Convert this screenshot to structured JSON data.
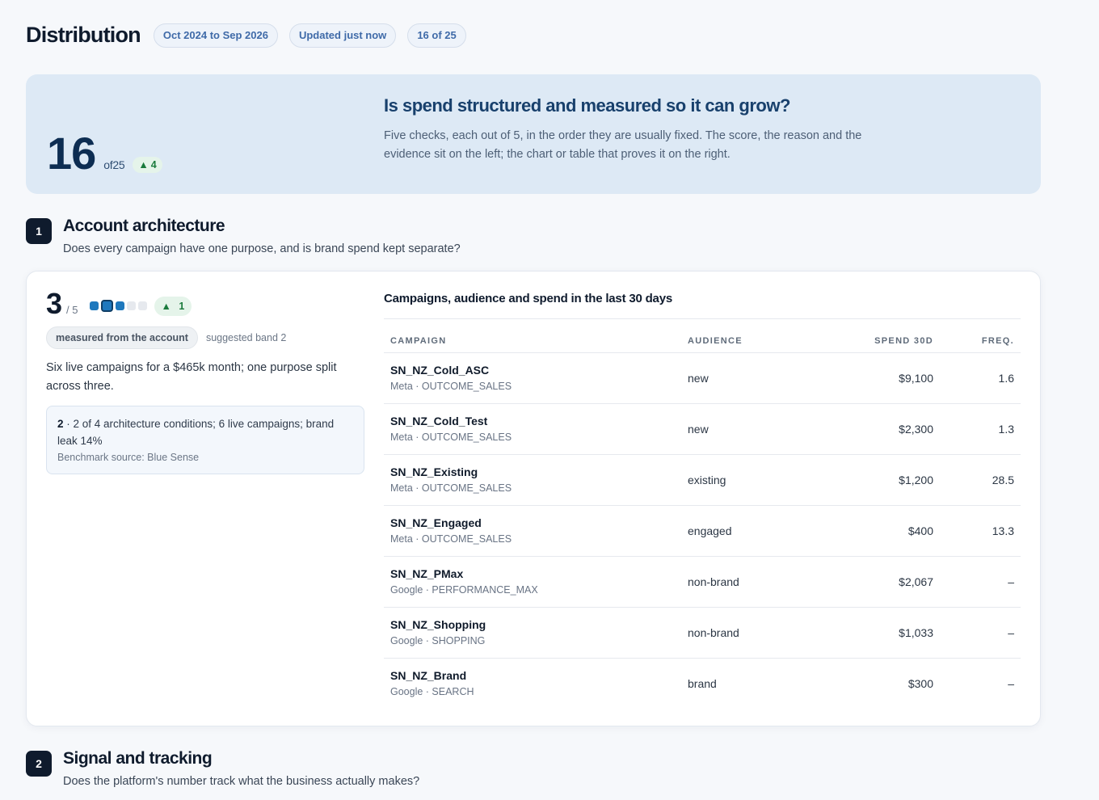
{
  "header": {
    "title": "Distribution",
    "pills": [
      "Oct 2024 to Sep 2026",
      "Updated just now",
      "16 of 25"
    ]
  },
  "hero": {
    "score": "16",
    "of_label": "of25",
    "delta": "4",
    "question": "Is spend structured and measured so it can grow?",
    "description": "Five checks, each out of 5, in the order they are usually fixed. The score, the reason and the evidence sit on the left; the chart or table that proves it on the right."
  },
  "sections": [
    {
      "number": "1",
      "title": "Account architecture",
      "subtitle": "Does every campaign have one purpose, and is brand spend kept separate?"
    },
    {
      "number": "2",
      "title": "Signal and tracking",
      "subtitle": "Does the platform's number track what the business actually makes?"
    }
  ],
  "card": {
    "score": "3",
    "of_label": "/ 5",
    "score_value": 3,
    "score_max": 5,
    "delta": "1",
    "tag": "measured from the account",
    "band": "suggested band 2",
    "description": "Six live campaigns for a $465k month; one purpose split across three.",
    "evidence": {
      "lead": "2",
      "text": " · 2 of 4 architecture conditions; 6 live campaigns; brand leak 14%",
      "source": "Benchmark source: Blue Sense"
    },
    "table": {
      "title": "Campaigns, audience and spend in the last 30 days",
      "headers": {
        "campaign": "CAMPAIGN",
        "audience": "AUDIENCE",
        "spend": "SPEND 30D",
        "freq": "FREQ."
      },
      "rows": [
        {
          "name": "SN_NZ_Cold_ASC",
          "meta": "Meta · OUTCOME_SALES",
          "audience": "new",
          "spend": "$9,100",
          "freq": "1.6"
        },
        {
          "name": "SN_NZ_Cold_Test",
          "meta": "Meta · OUTCOME_SALES",
          "audience": "new",
          "spend": "$2,300",
          "freq": "1.3"
        },
        {
          "name": "SN_NZ_Existing",
          "meta": "Meta · OUTCOME_SALES",
          "audience": "existing",
          "spend": "$1,200",
          "freq": "28.5"
        },
        {
          "name": "SN_NZ_Engaged",
          "meta": "Meta · OUTCOME_SALES",
          "audience": "engaged",
          "spend": "$400",
          "freq": "13.3"
        },
        {
          "name": "SN_NZ_PMax",
          "meta": "Google · PERFORMANCE_MAX",
          "audience": "non-brand",
          "spend": "$2,067",
          "freq": "–"
        },
        {
          "name": "SN_NZ_Shopping",
          "meta": "Google · SHOPPING",
          "audience": "non-brand",
          "spend": "$1,033",
          "freq": "–"
        },
        {
          "name": "SN_NZ_Brand",
          "meta": "Google · SEARCH",
          "audience": "brand",
          "spend": "$300",
          "freq": "–"
        }
      ]
    }
  },
  "icons": {
    "delta_up": "up-triangle-icon"
  },
  "colors": {
    "accent": "#1e78bd",
    "positive": "#1a7a3c",
    "hero_bg": "#dde9f5",
    "dark": "#0f1b2d"
  }
}
